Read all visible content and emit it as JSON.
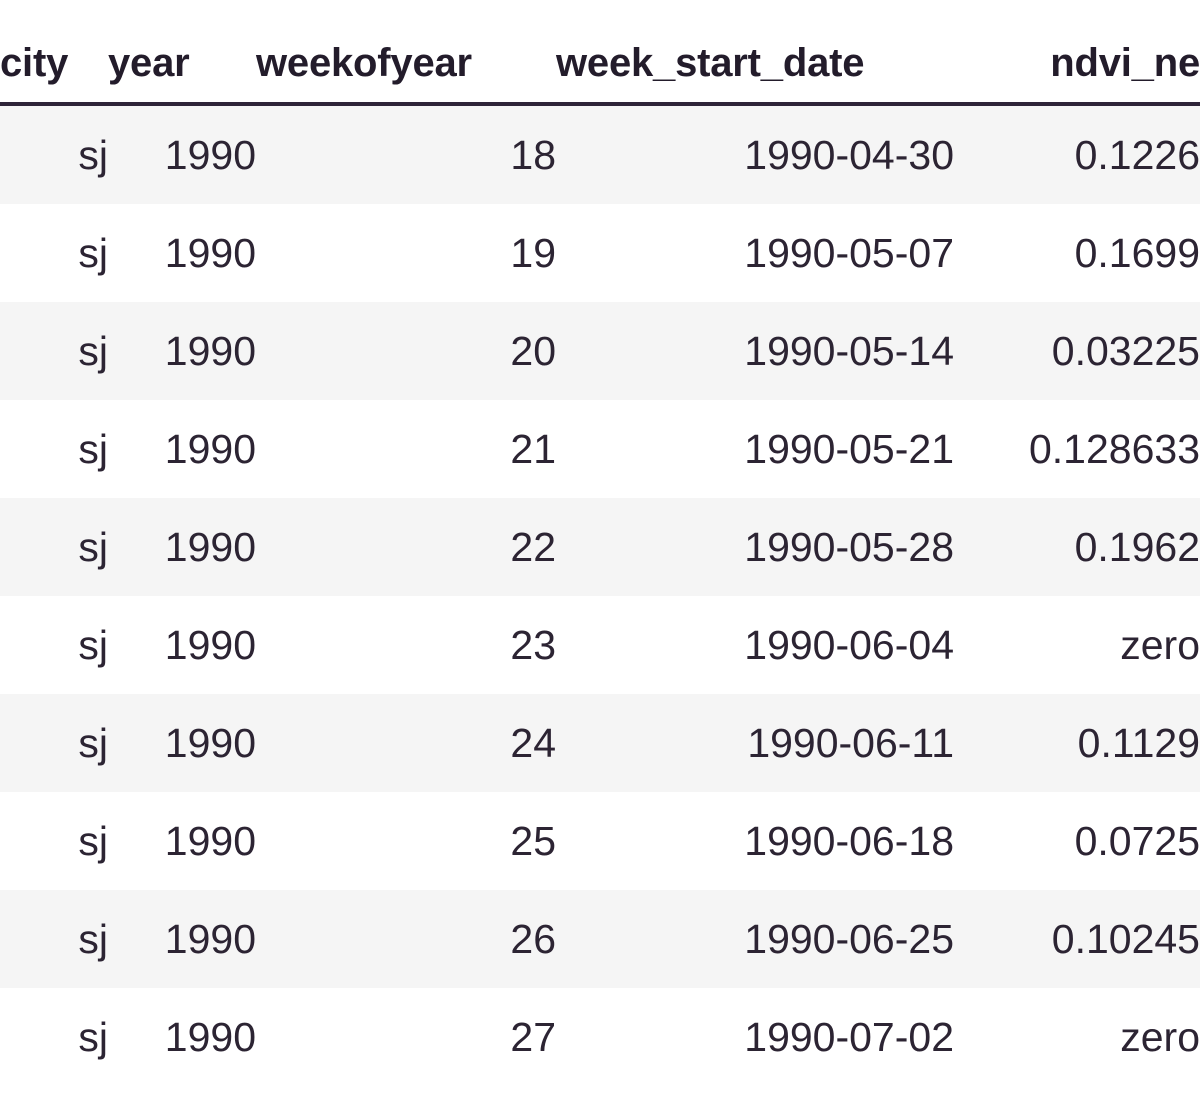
{
  "table": {
    "columns": [
      {
        "key": "city",
        "label": "city",
        "align": "right"
      },
      {
        "key": "year",
        "label": "year",
        "align": "right"
      },
      {
        "key": "weekofyear",
        "label": "weekofyear",
        "align": "right"
      },
      {
        "key": "week_start_date",
        "label": "week_start_date",
        "align": "right"
      },
      {
        "key": "ndvi_ne",
        "label": "ndvi_ne",
        "align": "right"
      }
    ],
    "rows": [
      {
        "city": "sj",
        "year": "1990",
        "weekofyear": "18",
        "week_start_date": "1990-04-30",
        "ndvi_ne": "0.1226"
      },
      {
        "city": "sj",
        "year": "1990",
        "weekofyear": "19",
        "week_start_date": "1990-05-07",
        "ndvi_ne": "0.1699"
      },
      {
        "city": "sj",
        "year": "1990",
        "weekofyear": "20",
        "week_start_date": "1990-05-14",
        "ndvi_ne": "0.03225"
      },
      {
        "city": "sj",
        "year": "1990",
        "weekofyear": "21",
        "week_start_date": "1990-05-21",
        "ndvi_ne": "0.128633"
      },
      {
        "city": "sj",
        "year": "1990",
        "weekofyear": "22",
        "week_start_date": "1990-05-28",
        "ndvi_ne": "0.1962"
      },
      {
        "city": "sj",
        "year": "1990",
        "weekofyear": "23",
        "week_start_date": "1990-06-04",
        "ndvi_ne": "zero"
      },
      {
        "city": "sj",
        "year": "1990",
        "weekofyear": "24",
        "week_start_date": "1990-06-11",
        "ndvi_ne": "0.1129"
      },
      {
        "city": "sj",
        "year": "1990",
        "weekofyear": "25",
        "week_start_date": "1990-06-18",
        "ndvi_ne": "0.0725"
      },
      {
        "city": "sj",
        "year": "1990",
        "weekofyear": "26",
        "week_start_date": "1990-06-25",
        "ndvi_ne": "0.10245"
      },
      {
        "city": "sj",
        "year": "1990",
        "weekofyear": "27",
        "week_start_date": "1990-07-02",
        "ndvi_ne": "zero"
      }
    ]
  },
  "style": {
    "text_color": "#2c2433",
    "header_color": "#231c2b",
    "header_rule_color": "#2e2438",
    "stripe_color": "#f5f5f5",
    "background_color": "#ffffff"
  }
}
